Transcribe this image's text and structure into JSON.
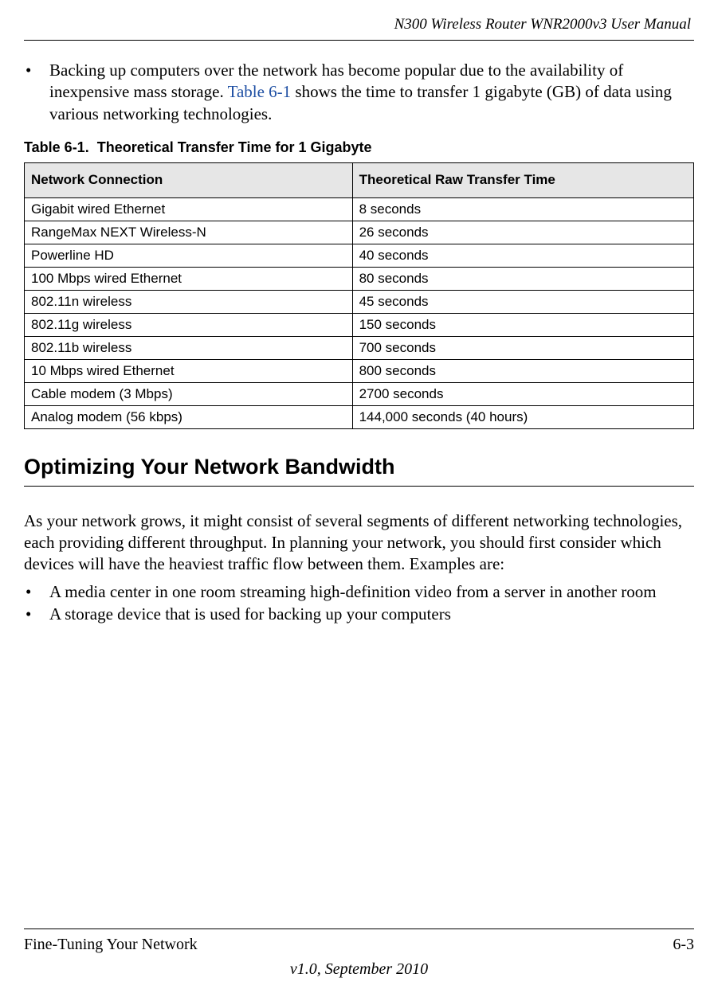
{
  "header": {
    "doc_title": "N300 Wireless Router WNR2000v3 User Manual"
  },
  "bullet1": {
    "dot": "•",
    "pre": "Backing up computers over the network has become popular due to the availability of inexpensive mass storage. ",
    "link": "Table 6-1",
    "post": " shows the time to transfer 1 gigabyte (GB) of data using various networking technologies."
  },
  "table": {
    "caption_label": "Table 6-1.",
    "caption_title": "Theoretical Transfer Time for 1 Gigabyte",
    "head_col1": "Network Connection",
    "head_col2": "Theoretical Raw Transfer Time",
    "rows": [
      {
        "c1": "Gigabit wired Ethernet",
        "c2": "8 seconds"
      },
      {
        "c1": "RangeMax NEXT Wireless-N",
        "c2": "26 seconds"
      },
      {
        "c1": "Powerline HD",
        "c2": "40 seconds"
      },
      {
        "c1": "100 Mbps wired Ethernet",
        "c2": "80 seconds"
      },
      {
        "c1": "802.11n wireless",
        "c2": "45 seconds"
      },
      {
        "c1": "802.11g wireless",
        "c2": "150 seconds"
      },
      {
        "c1": "802.11b wireless",
        "c2": "700 seconds"
      },
      {
        "c1": "10 Mbps wired Ethernet",
        "c2": "800 seconds"
      },
      {
        "c1": "Cable modem (3 Mbps)",
        "c2": "2700 seconds"
      },
      {
        "c1": "Analog modem (56 kbps)",
        "c2": "144,000 seconds (40 hours)"
      }
    ]
  },
  "heading": "Optimizing Your Network Bandwidth",
  "para": "As your network grows, it might consist of several segments of different networking technologies, each providing different throughput. In planning your network, you should first consider which devices will have the heaviest traffic flow between them. Examples are:",
  "bullets2": [
    {
      "dot": "•",
      "txt": "A media center in one room streaming high-definition video from a server in another room"
    },
    {
      "dot": "•",
      "txt": "A storage device that is used for backing up your computers"
    }
  ],
  "footer": {
    "chapter": "Fine-Tuning Your Network",
    "page": "6-3",
    "version": "v1.0, September 2010"
  }
}
